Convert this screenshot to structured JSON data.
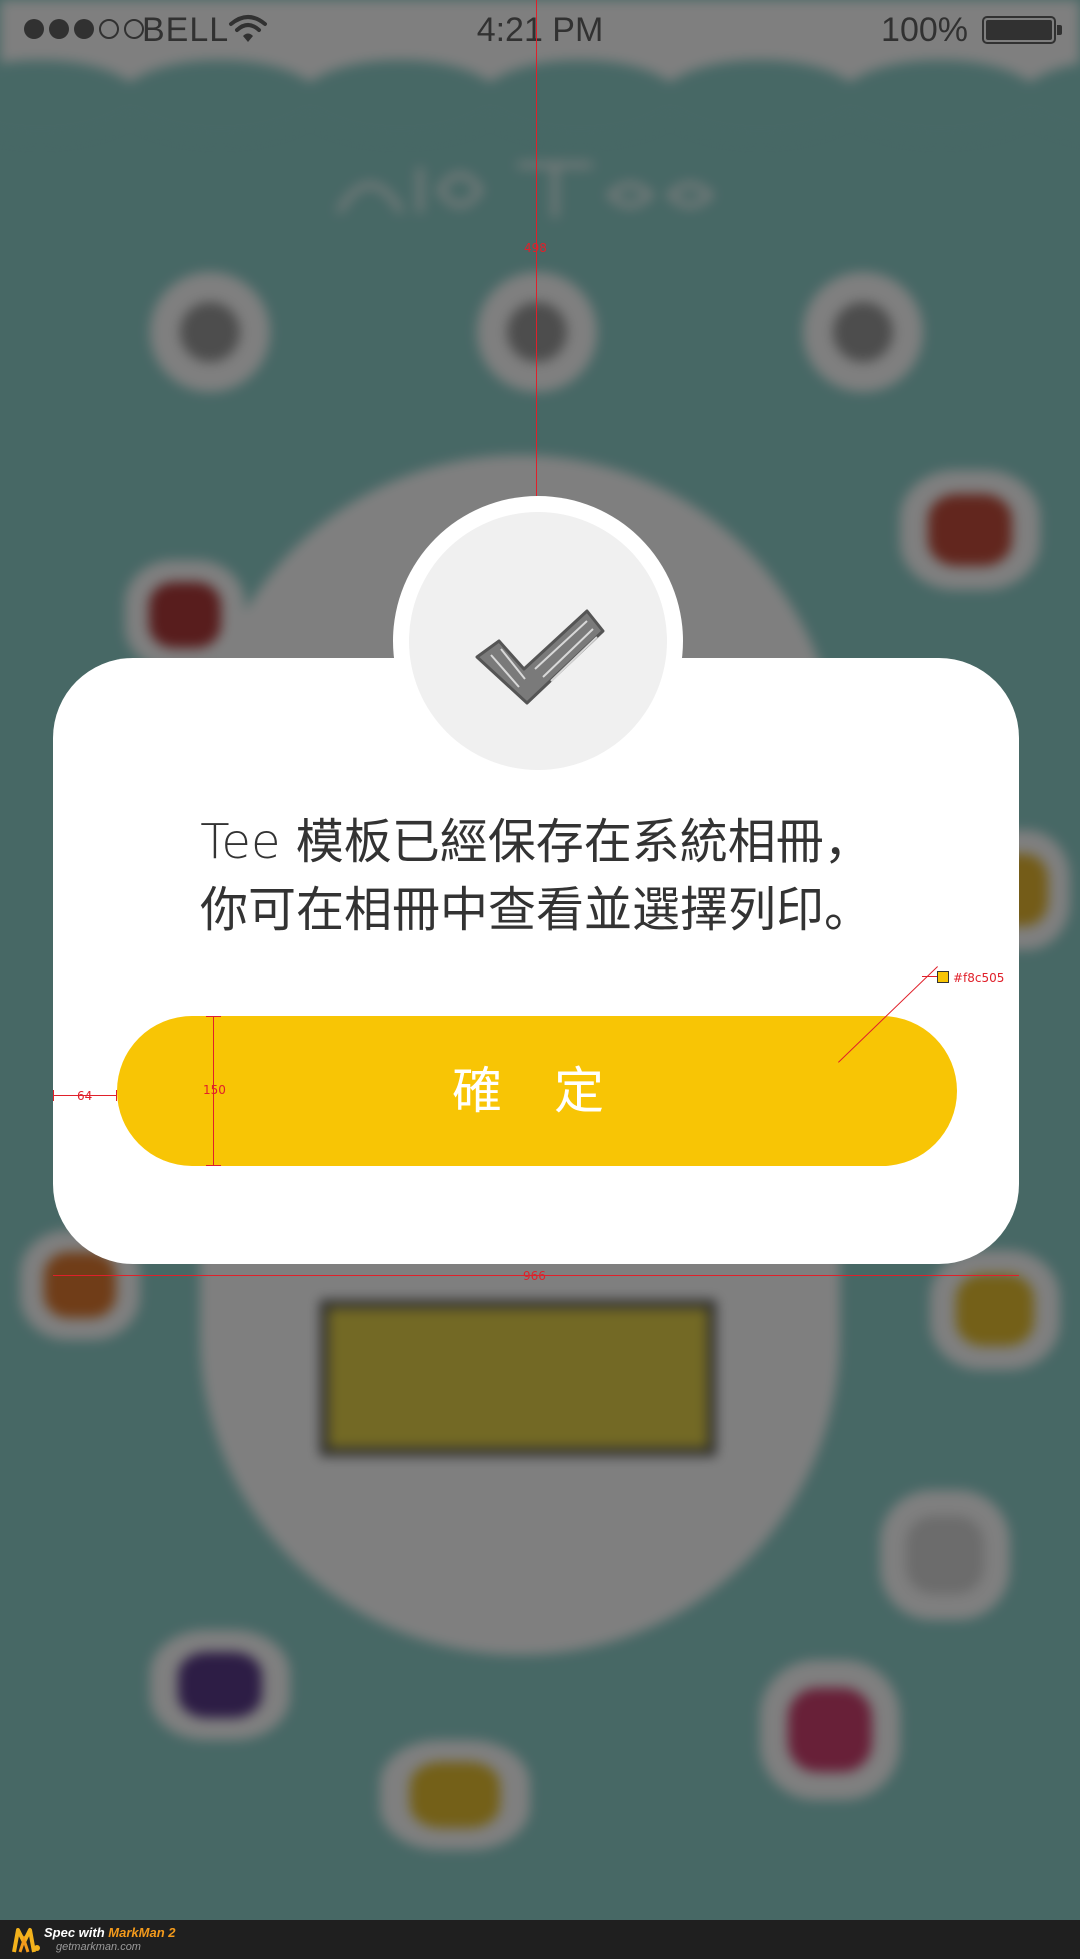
{
  "status_bar": {
    "carrier": "BELL",
    "time": "4:21 PM",
    "battery": "100%",
    "signal_bars_filled": 3,
    "signal_bars_total": 5
  },
  "dialog": {
    "message_line1": "Tee 模板已經保存在系統相冊，",
    "message_line2": "你可在相冊中查看並選擇列印。",
    "confirm_label": "確 定",
    "badge_icon": "checkmark-icon",
    "button_color": "#f8c505"
  },
  "annotations": {
    "top_distance": "498",
    "button_height": "150",
    "left_margin": "64",
    "card_width": "966",
    "color_callout": "#f8c505"
  },
  "footer": {
    "spec_prefix": "Spec with ",
    "brand": "MarkMan 2",
    "site": "getmarkman.com"
  },
  "colors": {
    "accent": "#f8c505",
    "background_teal": "#8fd0cb",
    "annotation_red": "#e0202a"
  }
}
